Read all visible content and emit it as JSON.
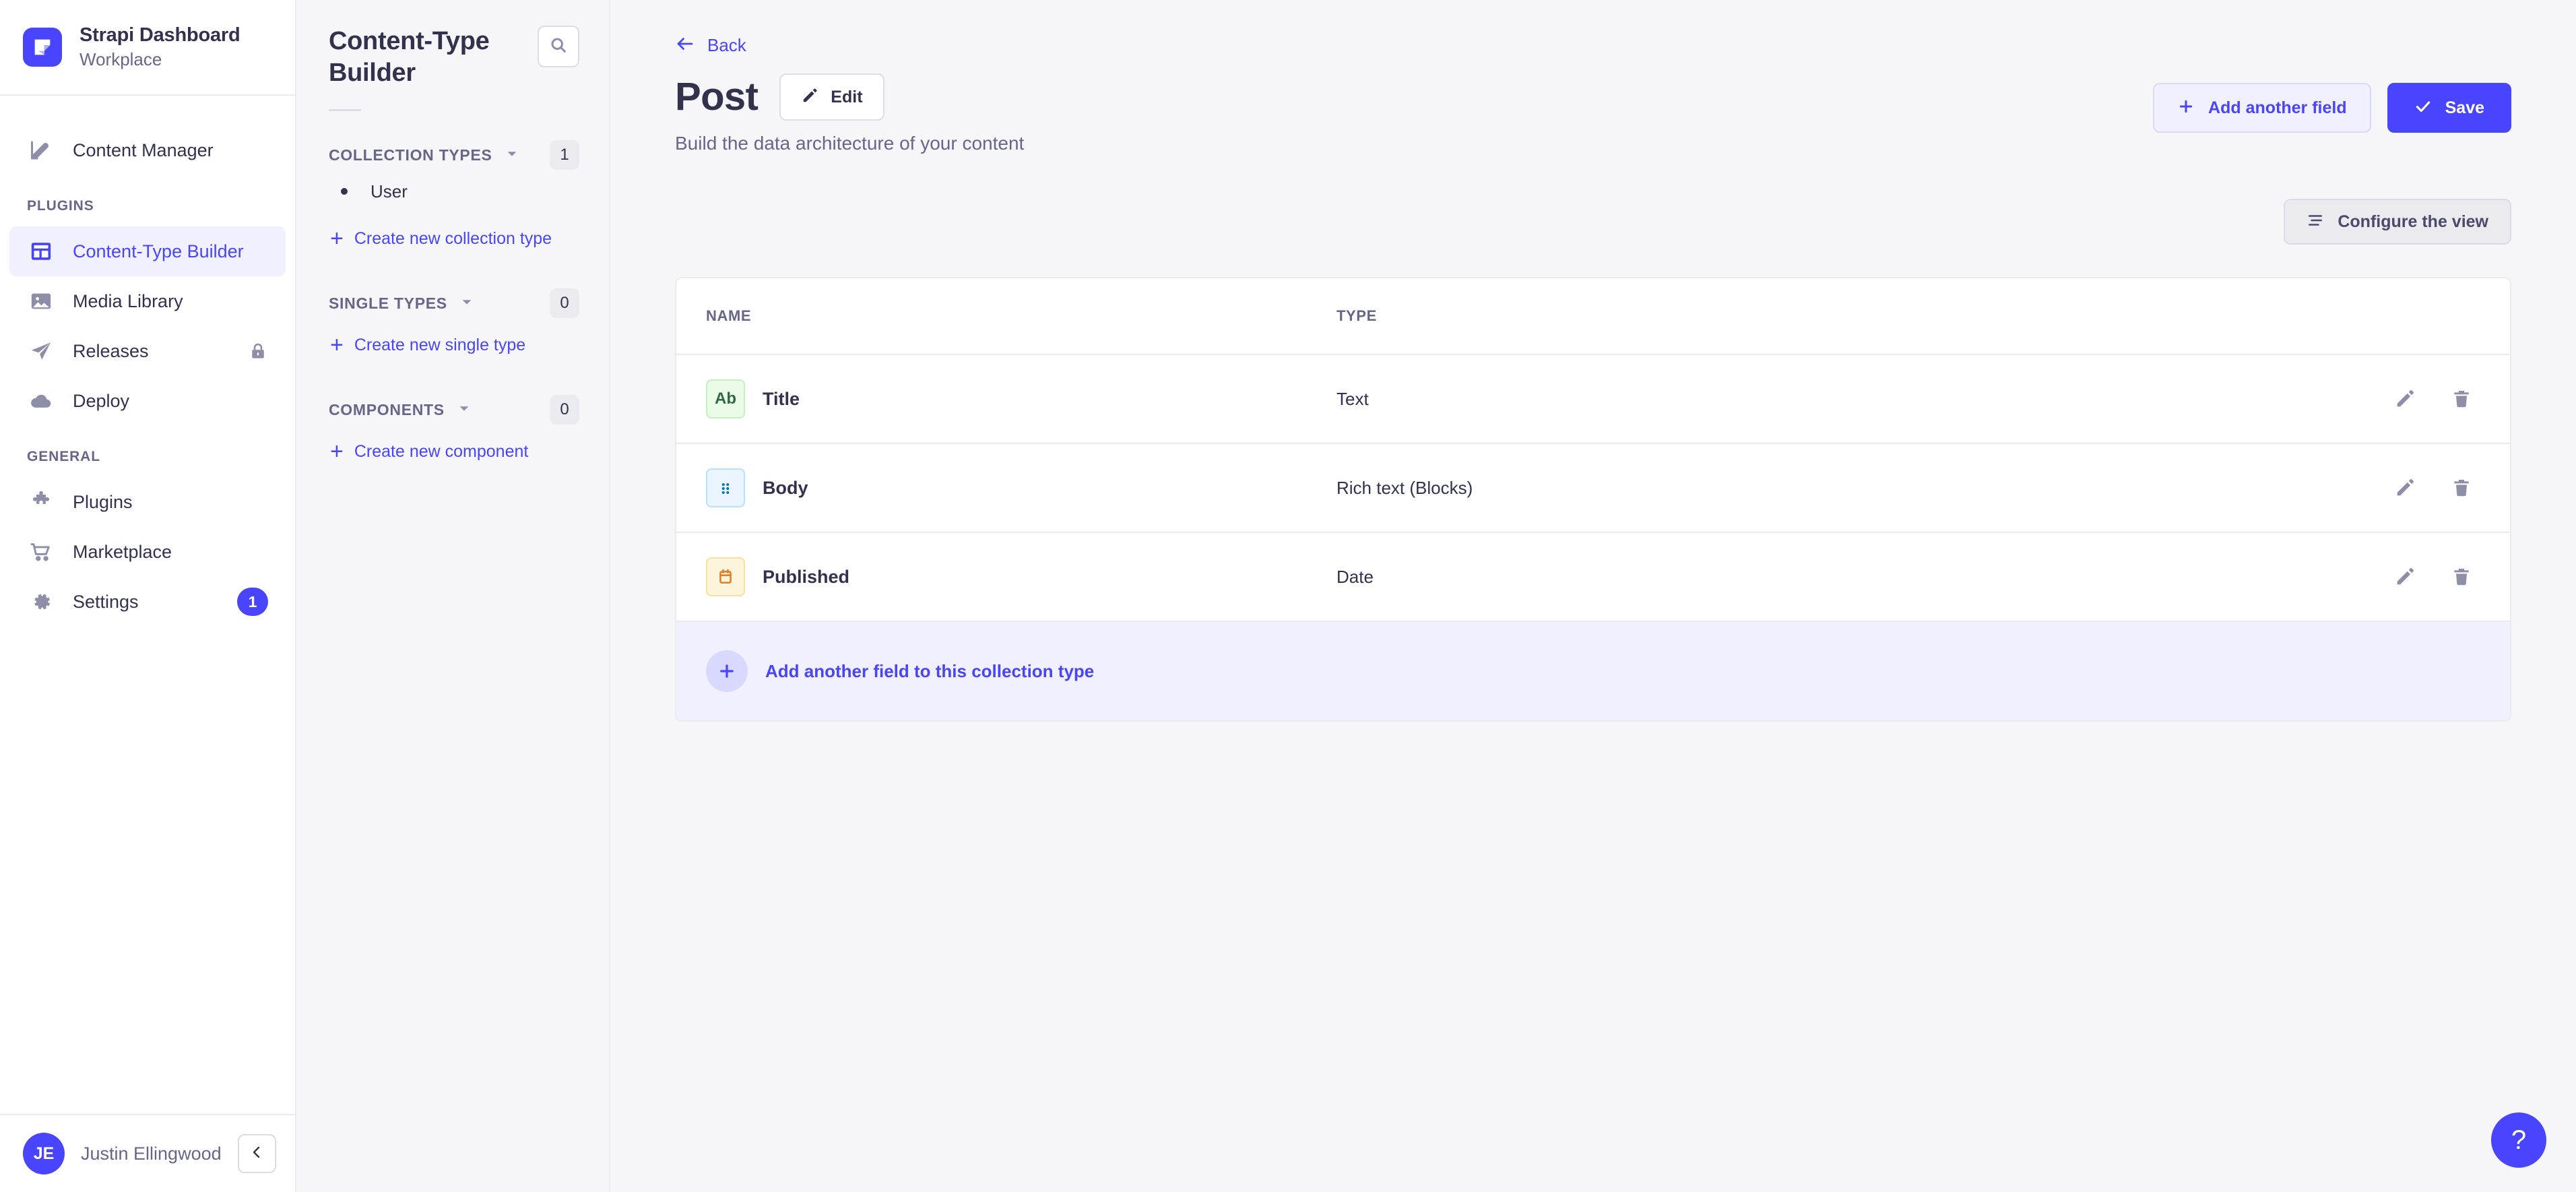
{
  "brand": {
    "logo_icon": "strapi-logo-icon",
    "title": "Strapi Dashboard",
    "subtitle": "Workplace",
    "accent_color": "#4945ff"
  },
  "sidebar": {
    "top_items": [
      {
        "label": "Content Manager",
        "icon": "feather-icon",
        "active": false
      }
    ],
    "sections": [
      {
        "label": "PLUGINS",
        "items": [
          {
            "label": "Content-Type Builder",
            "icon": "layout-grid-icon",
            "active": true,
            "trailing": ""
          },
          {
            "label": "Media Library",
            "icon": "image-icon",
            "active": false,
            "trailing": ""
          },
          {
            "label": "Releases",
            "icon": "paper-plane-icon",
            "active": false,
            "trailing": "lock-icon"
          },
          {
            "label": "Deploy",
            "icon": "cloud-icon",
            "active": false,
            "trailing": ""
          }
        ]
      },
      {
        "label": "GENERAL",
        "items": [
          {
            "label": "Plugins",
            "icon": "puzzle-icon",
            "active": false,
            "trailing": ""
          },
          {
            "label": "Marketplace",
            "icon": "shopping-cart-icon",
            "active": false,
            "trailing": ""
          },
          {
            "label": "Settings",
            "icon": "gear-icon",
            "active": false,
            "trailing": "badge",
            "badge": "1"
          }
        ]
      }
    ],
    "user": {
      "initials": "JE",
      "name": "Justin Ellingwood",
      "collapse_icon": "chevron-left-icon"
    }
  },
  "ctb_panel": {
    "title": "Content-Type Builder",
    "search_icon": "search-icon",
    "groups": [
      {
        "label": "COLLECTION TYPES",
        "count": "1",
        "chevron_icon": "caret-down-icon",
        "items": [
          {
            "name": "User"
          }
        ],
        "create_label": "Create new collection type"
      },
      {
        "label": "SINGLE TYPES",
        "count": "0",
        "chevron_icon": "caret-down-icon",
        "items": [],
        "create_label": "Create new single type"
      },
      {
        "label": "COMPONENTS",
        "count": "0",
        "chevron_icon": "caret-down-icon",
        "items": [],
        "create_label": "Create new component"
      }
    ]
  },
  "main": {
    "back_label": "Back",
    "back_icon": "arrow-left-icon",
    "title": "Post",
    "edit_label": "Edit",
    "edit_icon": "pencil-icon",
    "subtitle": "Build the data architecture of your content",
    "add_field_label": "Add another field",
    "add_field_icon": "plus-icon",
    "save_label": "Save",
    "save_icon": "check-icon",
    "configure_label": "Configure the view",
    "configure_icon": "sliders-icon",
    "table": {
      "columns": {
        "name": "NAME",
        "type": "TYPE"
      },
      "rows": [
        {
          "name": "Title",
          "type": "Text",
          "icon": "text-ab-icon",
          "icon_label": "Ab",
          "icon_bg": "#eafbe7",
          "icon_border": "#c6f0c2",
          "icon_fg": "#2f6846",
          "edit_icon": "pencil-icon",
          "delete_icon": "trash-icon"
        },
        {
          "name": "Body",
          "type": "Rich text (Blocks)",
          "icon": "blocks-dots-icon",
          "icon_label": "",
          "icon_bg": "#eaf5ff",
          "icon_border": "#b8e1ff",
          "icon_fg": "#0c75af",
          "edit_icon": "pencil-icon",
          "delete_icon": "trash-icon"
        },
        {
          "name": "Published",
          "type": "Date",
          "icon": "calendar-icon",
          "icon_label": "",
          "icon_bg": "#fdf4dc",
          "icon_border": "#f9e1a4",
          "icon_fg": "#d9822b",
          "edit_icon": "pencil-icon",
          "delete_icon": "trash-icon"
        }
      ]
    },
    "footer_label": "Add another field to this collection type",
    "footer_icon": "plus-icon",
    "help_label": "?"
  }
}
